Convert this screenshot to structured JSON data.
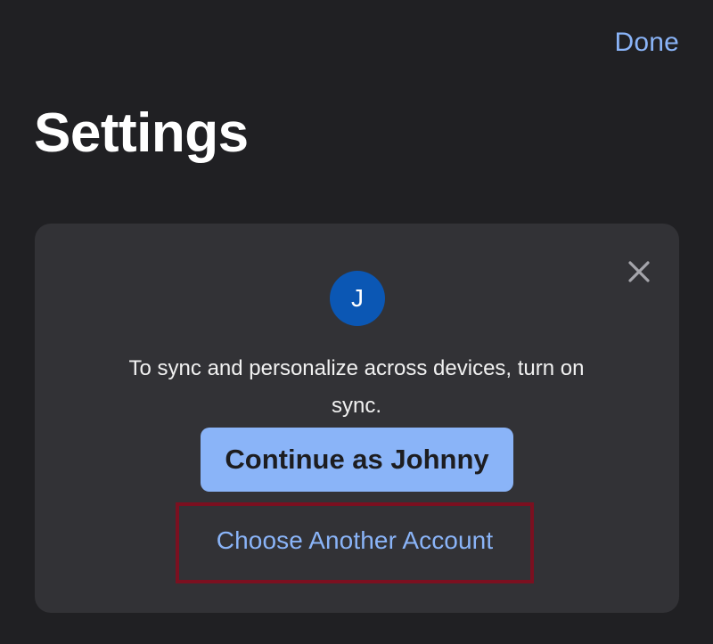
{
  "header": {
    "done_label": "Done",
    "title": "Settings"
  },
  "sync_card": {
    "avatar_initial": "J",
    "message": "To sync and personalize across devices, turn on sync.",
    "continue_label": "Continue as Johnny",
    "choose_another_label": "Choose Another Account",
    "close_icon": "close-icon"
  },
  "colors": {
    "background": "#202023",
    "card": "#323236",
    "accent": "#8ab4f8",
    "avatar": "#0b57b4",
    "highlight": "#7b1020"
  }
}
